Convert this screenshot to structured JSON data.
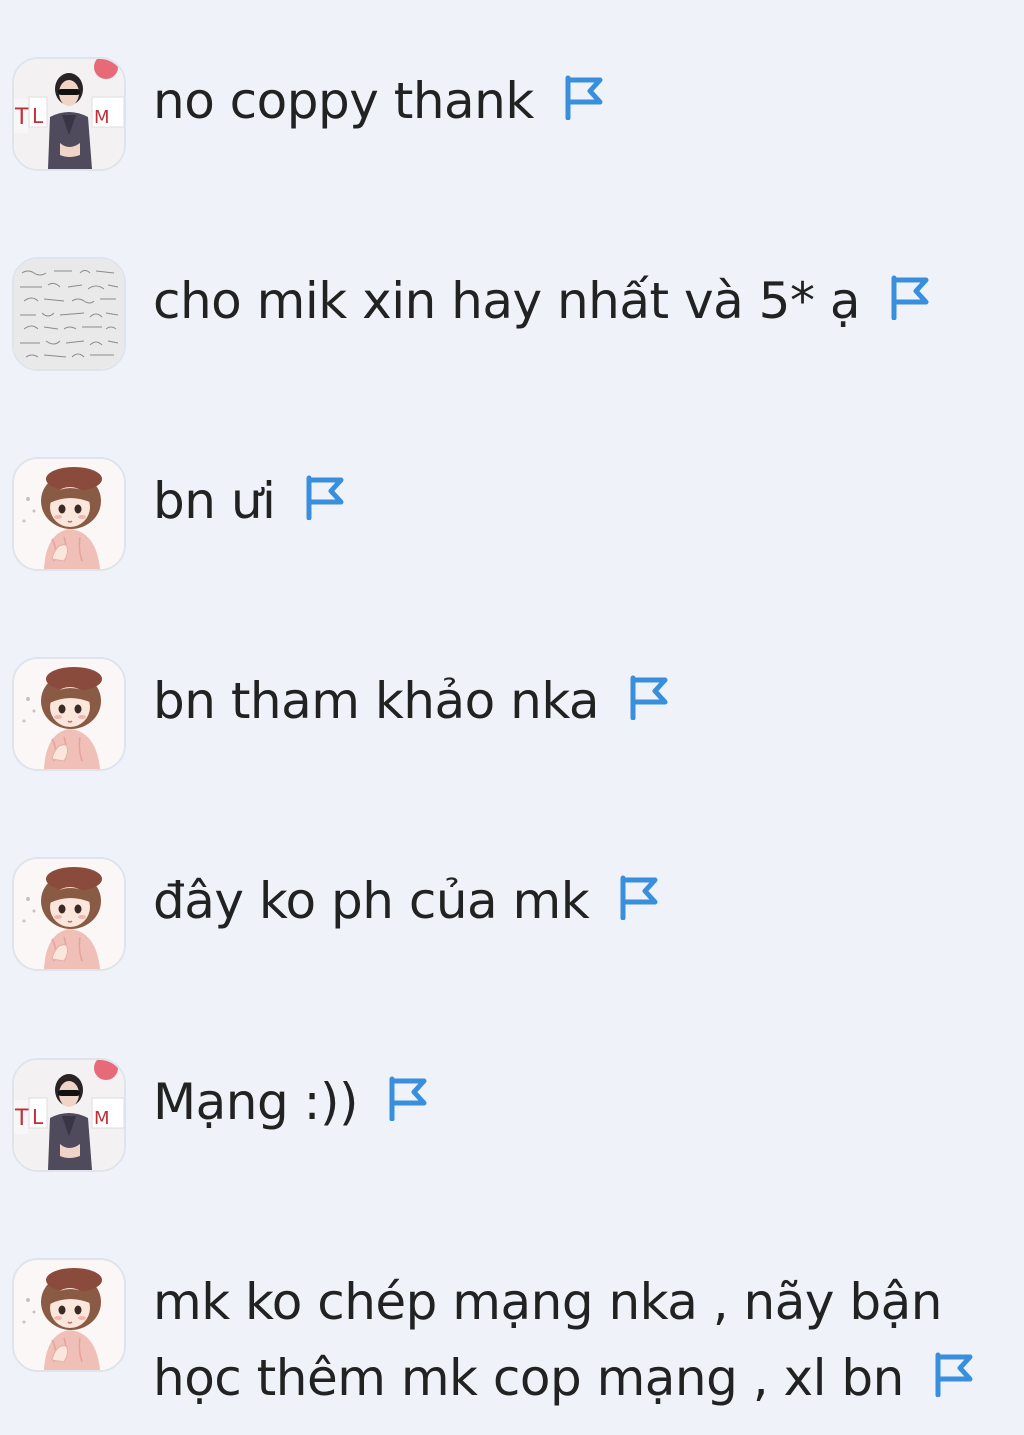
{
  "colors": {
    "background": "#eff3f9",
    "text": "#222222",
    "flag": "#3a8fdc"
  },
  "comments": [
    {
      "avatar": "photo-avatar-icon",
      "text": "no coppy thank",
      "action_icon": "report-flag-icon"
    },
    {
      "avatar": "math-notes-avatar-icon",
      "text": "cho mik xin hay nhất và 5* ạ",
      "action_icon": "report-flag-icon"
    },
    {
      "avatar": "anime-girl-avatar-icon",
      "text": "bn ưi",
      "action_icon": "report-flag-icon"
    },
    {
      "avatar": "anime-girl-avatar-icon",
      "text": "bn tham khảo nka",
      "action_icon": "report-flag-icon"
    },
    {
      "avatar": "anime-girl-avatar-icon",
      "text": "đây ko ph của mk",
      "action_icon": "report-flag-icon"
    },
    {
      "avatar": "photo-avatar-icon",
      "text": "Mạng :))",
      "action_icon": "report-flag-icon"
    },
    {
      "avatar": "anime-girl-avatar-icon",
      "text_lines": [
        "mk ko chép mạng nka , nãy bận",
        "học thêm mk cop mạng , xl bn"
      ],
      "action_icon": "report-flag-icon"
    }
  ]
}
